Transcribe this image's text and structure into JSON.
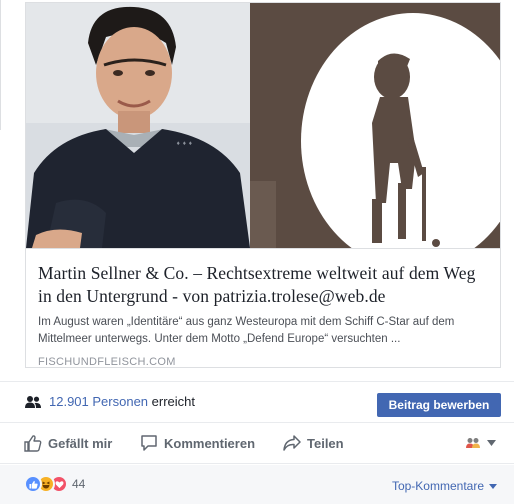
{
  "link_preview": {
    "title": "Martin Sellner & Co. – Rechtsextreme weltweit auf dem Weg in den Untergrund - von patrizia.trolese@web.de",
    "description": "Im August waren „Identitäre“ aus ganz Westeuropa mit dem Schiff C-Star auf dem Mittelmeer unterwegs. Unter dem Motto „Defend Europe“ versuchten ...",
    "domain": "FISCHUNDFLEISCH.COM",
    "image_left": "portrait-photo",
    "image_right": "silhouette-illustration"
  },
  "reach": {
    "count": "12.901",
    "people_word": "Personen",
    "suffix": "erreicht",
    "icon": "people-icon"
  },
  "boost_button": {
    "label": "Beitrag bewerben"
  },
  "actions": {
    "like": {
      "label": "Gefällt mir",
      "icon": "thumbs-up-icon"
    },
    "comment": {
      "label": "Kommentieren",
      "icon": "comment-icon"
    },
    "share": {
      "label": "Teilen",
      "icon": "share-arrow-icon"
    },
    "audience_icon": "friends-icon"
  },
  "reactions": {
    "count": "44",
    "icons": [
      "like-reaction-icon",
      "haha-reaction-icon",
      "love-reaction-icon"
    ]
  },
  "comments_filter": {
    "label": "Top-Kommentare"
  },
  "colors": {
    "brand_blue": "#4267b2",
    "link_blue": "#4267b2",
    "text_dark": "#1d2129",
    "text_muted": "#606770",
    "like_blue": "#5890ff",
    "haha_yellow": "#f7b125",
    "love_red": "#f25268"
  }
}
